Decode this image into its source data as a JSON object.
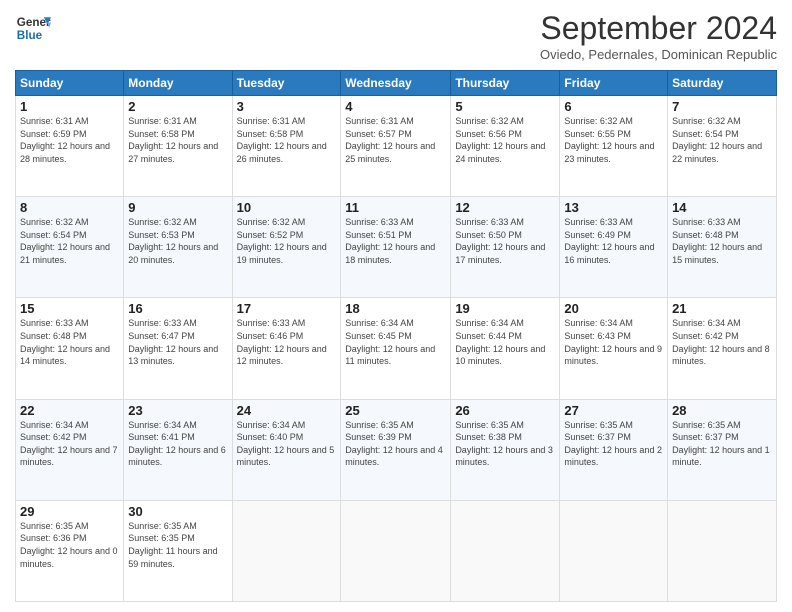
{
  "logo": {
    "line1": "General",
    "line2": "Blue"
  },
  "title": "September 2024",
  "subtitle": "Oviedo, Pedernales, Dominican Republic",
  "days_header": [
    "Sunday",
    "Monday",
    "Tuesday",
    "Wednesday",
    "Thursday",
    "Friday",
    "Saturday"
  ],
  "weeks": [
    [
      {
        "day": "1",
        "sunrise": "Sunrise: 6:31 AM",
        "sunset": "Sunset: 6:59 PM",
        "daylight": "Daylight: 12 hours and 28 minutes."
      },
      {
        "day": "2",
        "sunrise": "Sunrise: 6:31 AM",
        "sunset": "Sunset: 6:58 PM",
        "daylight": "Daylight: 12 hours and 27 minutes."
      },
      {
        "day": "3",
        "sunrise": "Sunrise: 6:31 AM",
        "sunset": "Sunset: 6:58 PM",
        "daylight": "Daylight: 12 hours and 26 minutes."
      },
      {
        "day": "4",
        "sunrise": "Sunrise: 6:31 AM",
        "sunset": "Sunset: 6:57 PM",
        "daylight": "Daylight: 12 hours and 25 minutes."
      },
      {
        "day": "5",
        "sunrise": "Sunrise: 6:32 AM",
        "sunset": "Sunset: 6:56 PM",
        "daylight": "Daylight: 12 hours and 24 minutes."
      },
      {
        "day": "6",
        "sunrise": "Sunrise: 6:32 AM",
        "sunset": "Sunset: 6:55 PM",
        "daylight": "Daylight: 12 hours and 23 minutes."
      },
      {
        "day": "7",
        "sunrise": "Sunrise: 6:32 AM",
        "sunset": "Sunset: 6:54 PM",
        "daylight": "Daylight: 12 hours and 22 minutes."
      }
    ],
    [
      {
        "day": "8",
        "sunrise": "Sunrise: 6:32 AM",
        "sunset": "Sunset: 6:54 PM",
        "daylight": "Daylight: 12 hours and 21 minutes."
      },
      {
        "day": "9",
        "sunrise": "Sunrise: 6:32 AM",
        "sunset": "Sunset: 6:53 PM",
        "daylight": "Daylight: 12 hours and 20 minutes."
      },
      {
        "day": "10",
        "sunrise": "Sunrise: 6:32 AM",
        "sunset": "Sunset: 6:52 PM",
        "daylight": "Daylight: 12 hours and 19 minutes."
      },
      {
        "day": "11",
        "sunrise": "Sunrise: 6:33 AM",
        "sunset": "Sunset: 6:51 PM",
        "daylight": "Daylight: 12 hours and 18 minutes."
      },
      {
        "day": "12",
        "sunrise": "Sunrise: 6:33 AM",
        "sunset": "Sunset: 6:50 PM",
        "daylight": "Daylight: 12 hours and 17 minutes."
      },
      {
        "day": "13",
        "sunrise": "Sunrise: 6:33 AM",
        "sunset": "Sunset: 6:49 PM",
        "daylight": "Daylight: 12 hours and 16 minutes."
      },
      {
        "day": "14",
        "sunrise": "Sunrise: 6:33 AM",
        "sunset": "Sunset: 6:48 PM",
        "daylight": "Daylight: 12 hours and 15 minutes."
      }
    ],
    [
      {
        "day": "15",
        "sunrise": "Sunrise: 6:33 AM",
        "sunset": "Sunset: 6:48 PM",
        "daylight": "Daylight: 12 hours and 14 minutes."
      },
      {
        "day": "16",
        "sunrise": "Sunrise: 6:33 AM",
        "sunset": "Sunset: 6:47 PM",
        "daylight": "Daylight: 12 hours and 13 minutes."
      },
      {
        "day": "17",
        "sunrise": "Sunrise: 6:33 AM",
        "sunset": "Sunset: 6:46 PM",
        "daylight": "Daylight: 12 hours and 12 minutes."
      },
      {
        "day": "18",
        "sunrise": "Sunrise: 6:34 AM",
        "sunset": "Sunset: 6:45 PM",
        "daylight": "Daylight: 12 hours and 11 minutes."
      },
      {
        "day": "19",
        "sunrise": "Sunrise: 6:34 AM",
        "sunset": "Sunset: 6:44 PM",
        "daylight": "Daylight: 12 hours and 10 minutes."
      },
      {
        "day": "20",
        "sunrise": "Sunrise: 6:34 AM",
        "sunset": "Sunset: 6:43 PM",
        "daylight": "Daylight: 12 hours and 9 minutes."
      },
      {
        "day": "21",
        "sunrise": "Sunrise: 6:34 AM",
        "sunset": "Sunset: 6:42 PM",
        "daylight": "Daylight: 12 hours and 8 minutes."
      }
    ],
    [
      {
        "day": "22",
        "sunrise": "Sunrise: 6:34 AM",
        "sunset": "Sunset: 6:42 PM",
        "daylight": "Daylight: 12 hours and 7 minutes."
      },
      {
        "day": "23",
        "sunrise": "Sunrise: 6:34 AM",
        "sunset": "Sunset: 6:41 PM",
        "daylight": "Daylight: 12 hours and 6 minutes."
      },
      {
        "day": "24",
        "sunrise": "Sunrise: 6:34 AM",
        "sunset": "Sunset: 6:40 PM",
        "daylight": "Daylight: 12 hours and 5 minutes."
      },
      {
        "day": "25",
        "sunrise": "Sunrise: 6:35 AM",
        "sunset": "Sunset: 6:39 PM",
        "daylight": "Daylight: 12 hours and 4 minutes."
      },
      {
        "day": "26",
        "sunrise": "Sunrise: 6:35 AM",
        "sunset": "Sunset: 6:38 PM",
        "daylight": "Daylight: 12 hours and 3 minutes."
      },
      {
        "day": "27",
        "sunrise": "Sunrise: 6:35 AM",
        "sunset": "Sunset: 6:37 PM",
        "daylight": "Daylight: 12 hours and 2 minutes."
      },
      {
        "day": "28",
        "sunrise": "Sunrise: 6:35 AM",
        "sunset": "Sunset: 6:37 PM",
        "daylight": "Daylight: 12 hours and 1 minute."
      }
    ],
    [
      {
        "day": "29",
        "sunrise": "Sunrise: 6:35 AM",
        "sunset": "Sunset: 6:36 PM",
        "daylight": "Daylight: 12 hours and 0 minutes."
      },
      {
        "day": "30",
        "sunrise": "Sunrise: 6:35 AM",
        "sunset": "Sunset: 6:35 PM",
        "daylight": "Daylight: 11 hours and 59 minutes."
      },
      null,
      null,
      null,
      null,
      null
    ]
  ]
}
